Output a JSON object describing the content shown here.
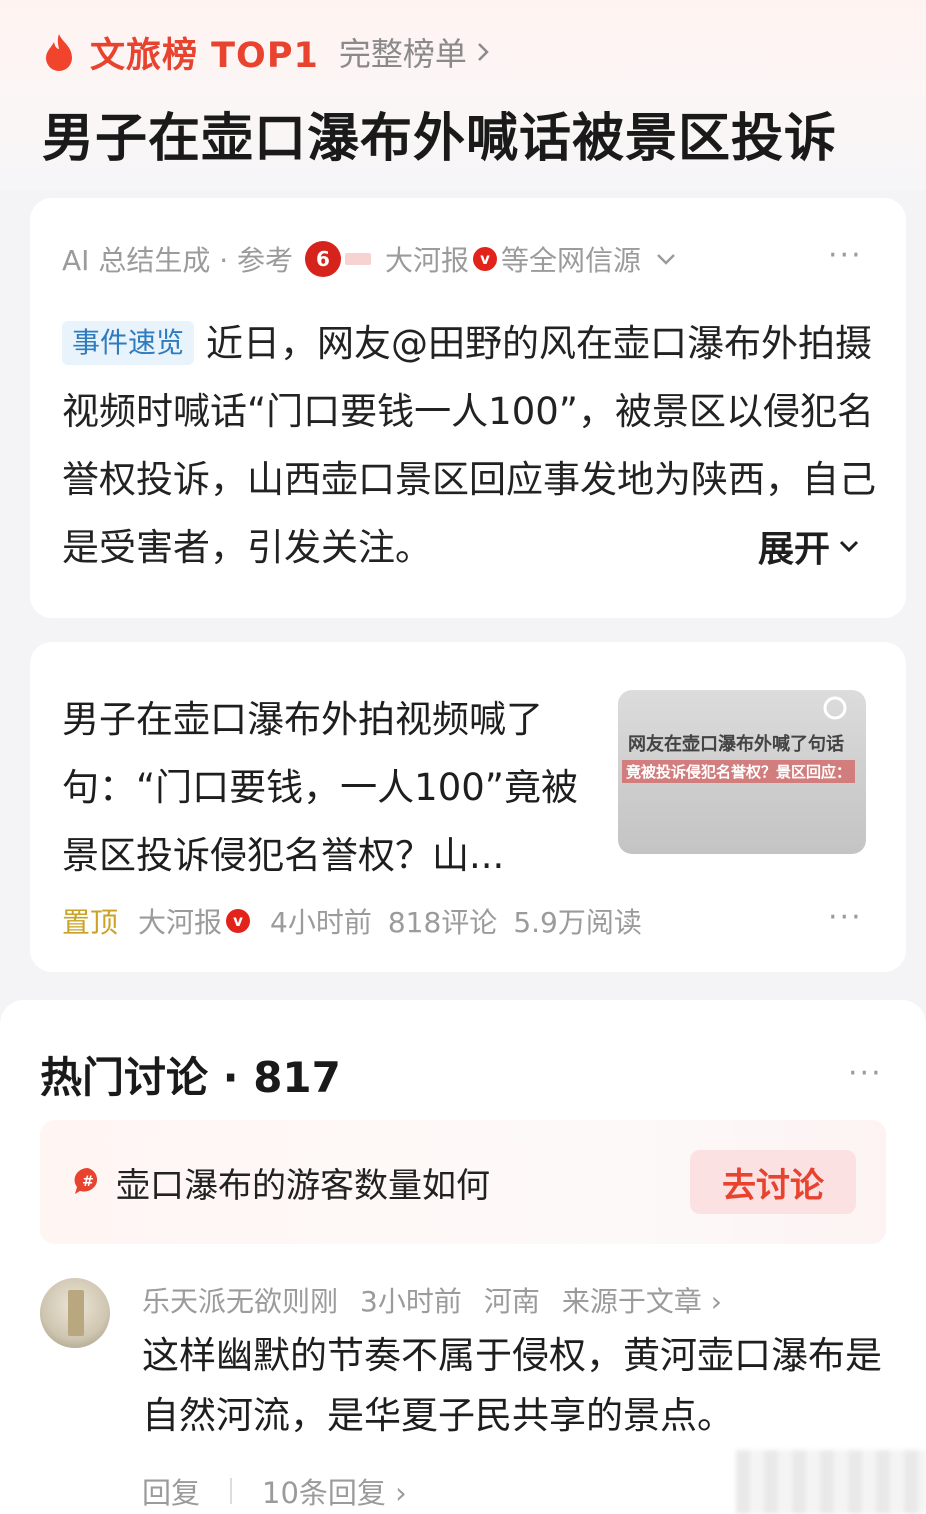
{
  "header": {
    "rank_label": "文旅榜 TOP1",
    "full_list": "完整榜单",
    "title": "男子在壶口瀑布外喊话被景区投诉"
  },
  "ai_summary": {
    "meta_prefix": "AI 总结生成 · 参考",
    "source": "大河报",
    "source_suffix": "等全网信源",
    "tag": "事件速览",
    "text": "近日，网友@田野的风在壶口瀑布外拍摄视频时喊话“门口要钱一人100”，被景区以侵犯名誉权投诉，山西壶口景区回应事发地为陕西，自己是受害者，引发关注。",
    "expand": "展开",
    "verified_mark": "v"
  },
  "news": {
    "title": "男子在壶口瀑布外拍视频喊了句：“门口要钱，一人100”竟被景区投诉侵犯名誉权？山...",
    "thumb_line1": "网友在壶口瀑布外喊了句话",
    "thumb_line2": "竟被投诉侵犯名誉权？景区回应：",
    "pinned": "置顶",
    "source": "大河报",
    "time": "4小时前",
    "comments": "818评论",
    "reads": "5.9万阅读",
    "verified_mark": "v"
  },
  "hot_discussion": {
    "title": "热门讨论 · 817",
    "topic": "壶口瀑布的游客数量如何",
    "topic_icon_mark": "#",
    "go_button": "去讨论"
  },
  "comment": {
    "user": "乐天派无欲则刚",
    "time": "3小时前",
    "location": "河南",
    "source": "来源于文章 ›",
    "text": "这样幽默的节奏不属于侵权，黄河壶口瀑布是自然河流，是华夏子民共享的景点。",
    "reply": "回复",
    "reply_count": "10条回复 ›"
  },
  "icons": {
    "flame": "flame-icon",
    "more": "more-dots-icon",
    "chevron": "chevron-icon"
  },
  "colors": {
    "accent": "#e8432f",
    "verified": "#e2231a",
    "tag_blue": "#2e7bbf",
    "pinned_gold": "#c9a227"
  }
}
